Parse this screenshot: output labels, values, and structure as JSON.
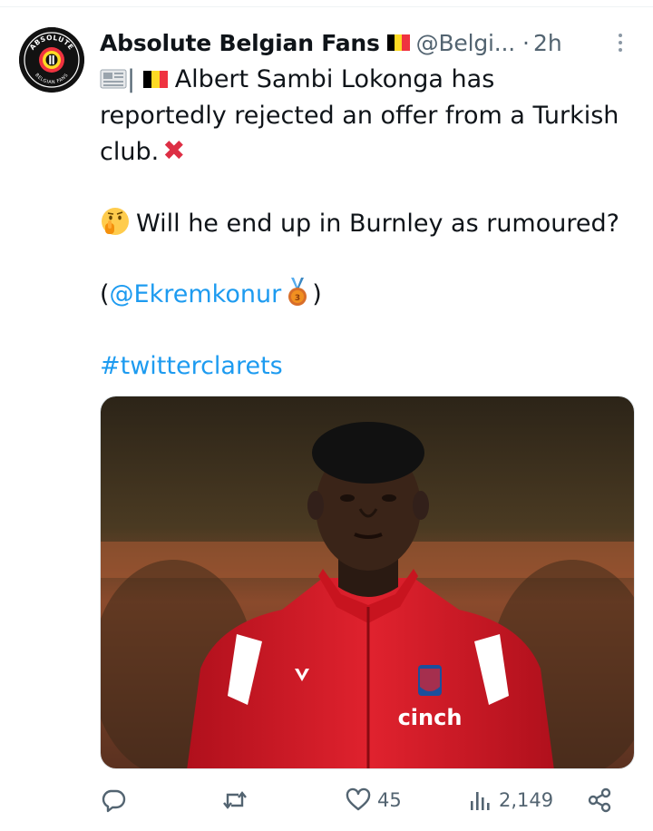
{
  "tweet": {
    "author_name": "Absolute Belgian Fans",
    "author_handle": "@Belgi...",
    "separator": "·",
    "time": "2h",
    "avatar": {
      "text_top": "ABSOLUTE",
      "text_bottom": "BELGIAN FANS"
    },
    "text": {
      "line1": "Albert Sambi Lokonga has",
      "line2": "reportedly rejected an offer from a Turkish",
      "line3": "club.",
      "line4": "Will he end up in Burnley as rumoured?",
      "line5_open": "(",
      "line5_mention": "@Ekremkonur",
      "line5_close": ")",
      "hashtag": "#twitterclarets"
    },
    "media": {
      "shirt_sponsor": "cinch"
    }
  },
  "actions": {
    "reply": {
      "icon": "reply-icon",
      "count": ""
    },
    "retweet": {
      "icon": "retweet-icon",
      "count": ""
    },
    "like": {
      "icon": "heart-icon",
      "count": "45"
    },
    "views": {
      "icon": "views-icon",
      "count": "2,149"
    },
    "share": {
      "icon": "share-icon",
      "count": ""
    }
  },
  "colors": {
    "text": "#0f1419",
    "secondary": "#536471",
    "link": "#1d9bf0",
    "belgium_black": "#000000",
    "belgium_yellow": "#fdda24",
    "belgium_red": "#ef3340"
  }
}
